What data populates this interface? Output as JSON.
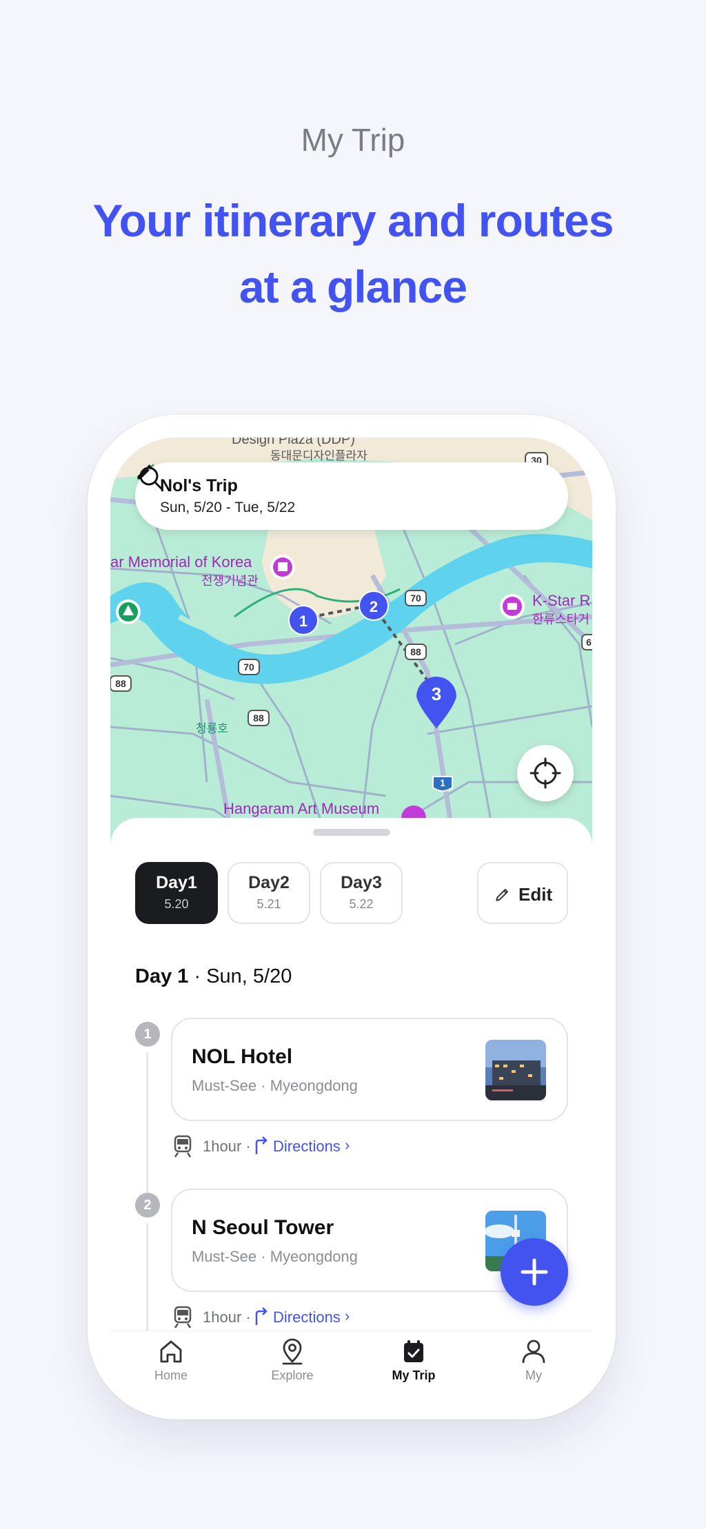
{
  "header": {
    "subtitle": "My Trip",
    "title_line1": "Your itinerary and routes",
    "title_line2": "at a glance"
  },
  "trip": {
    "name": "Nol's Trip",
    "dates": "Sun, 5/20 - Tue, 5/22"
  },
  "map": {
    "labels": {
      "top1": "Design Plaza (DDP)",
      "top2": "동대문디자인플라자",
      "memorial": "ar Memorial of Korea",
      "memorial_kr": "전쟁기념관",
      "kstar": "K-Star R",
      "kstar_kr": "한류스타거",
      "lake": "청룡호",
      "museum": "Hangaram Art Museum",
      "road_30": "30",
      "road_70a": "70",
      "road_70b": "70",
      "road_88a": "88",
      "road_88b": "88",
      "road_88c": "88",
      "road_1": "1",
      "road_6": "6"
    },
    "pins": [
      "1",
      "2",
      "3"
    ]
  },
  "days": {
    "tabs": [
      {
        "label": "Day1",
        "date": "5.20"
      },
      {
        "label": "Day2",
        "date": "5.21"
      },
      {
        "label": "Day3",
        "date": "5.22"
      }
    ],
    "active": 0,
    "edit_label": "Edit"
  },
  "day_heading": {
    "day": "Day 1",
    "sep": "·",
    "date": "Sun, 5/20"
  },
  "stops": [
    {
      "num": "1",
      "name": "NOL Hotel",
      "meta": "Must-See · Myeongdong",
      "transit": "1hour ·",
      "directions": "Directions"
    },
    {
      "num": "2",
      "name": "N Seoul Tower",
      "meta": "Must-See · Myeongdong",
      "transit": "1hour ·",
      "directions": "Directions"
    }
  ],
  "nav": [
    {
      "label": "Home",
      "icon": "home-icon"
    },
    {
      "label": "Explore",
      "icon": "map-pin-icon"
    },
    {
      "label": "My Trip",
      "icon": "calendar-check-icon"
    },
    {
      "label": "My",
      "icon": "user-icon"
    }
  ],
  "nav_active": "My Trip",
  "colors": {
    "accent": "#4353f0",
    "background": "#f5f6fb",
    "map_green": "#b9ecd6",
    "river": "#5fd3ee"
  }
}
